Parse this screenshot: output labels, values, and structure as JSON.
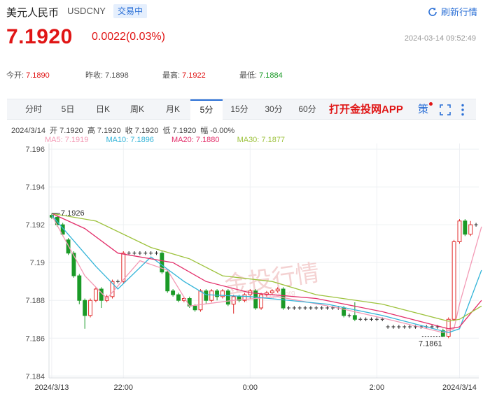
{
  "header": {
    "title": "美元人民币",
    "code": "USDCNY",
    "status": "交易中",
    "refresh_label": "刷新行情"
  },
  "quote": {
    "price": "7.1920",
    "change": "0.0022(0.03%)",
    "timestamp": "2024-03-14 09:52:49"
  },
  "stats": {
    "open_label": "今开:",
    "open": "7.1890",
    "prev_close_label": "昨收:",
    "prev_close": "7.1898",
    "high_label": "最高:",
    "high": "7.1922",
    "low_label": "最低:",
    "low": "7.1884"
  },
  "tabs": [
    "分时",
    "5日",
    "日K",
    "周K",
    "月K",
    "5分",
    "15分",
    "30分",
    "60分"
  ],
  "active_tab": "5分",
  "promo": "打开金投网APP",
  "tools": {
    "strategy": "策"
  },
  "ohlc_line": "2024/3/14  开 7.1920  高 7.1920  收 7.1920  低 7.1920  幅 -0.00%",
  "ma_legend": [
    {
      "label": "MA5: 7.1919",
      "color": "#f39ab5"
    },
    {
      "label": "MA10: 7.1896",
      "color": "#33b4d8"
    },
    {
      "label": "MA20: 7.1880",
      "color": "#e3306b"
    },
    {
      "label": "MA30: 7.1877",
      "color": "#9dc23c"
    }
  ],
  "watermark": "金投行情",
  "watermark_url": "quote.cngold.org",
  "chart_data": {
    "type": "candlestick",
    "y_ticks": [
      "7.196",
      "7.194",
      "7.192",
      "7.19",
      "7.188",
      "7.186",
      "7.184"
    ],
    "y_tick_values": [
      7.196,
      7.194,
      7.192,
      7.19,
      7.188,
      7.186,
      7.184
    ],
    "ylim": [
      7.1839,
      7.1963
    ],
    "x_labels": [
      "2024/3/13",
      "22:00",
      "0:00",
      "2:00",
      "2024/3/14"
    ],
    "x_label_index": [
      0,
      13,
      36,
      59,
      74
    ],
    "annotations": {
      "max": "7.1926",
      "min": "7.1861"
    },
    "candles": [
      [
        7.1925,
        7.1924,
        7.1926,
        7.1923
      ],
      [
        7.1924,
        7.192,
        7.1925,
        7.1919
      ],
      [
        7.192,
        7.1915,
        7.1921,
        7.1914
      ],
      [
        7.1912,
        7.1905,
        7.1913,
        7.1904
      ],
      [
        7.1905,
        7.1893,
        7.1906,
        7.1892
      ],
      [
        7.1893,
        7.188,
        7.1894,
        7.1878
      ],
      [
        7.188,
        7.1872,
        7.1881,
        7.1865
      ],
      [
        7.1872,
        7.188,
        7.1881,
        7.1871
      ],
      [
        7.188,
        7.1886,
        7.1887,
        7.1879
      ],
      [
        7.1886,
        7.188,
        7.1887,
        7.1876
      ],
      [
        7.188,
        7.1882,
        7.1883,
        7.1879
      ],
      [
        7.1882,
        7.189,
        7.1891,
        7.1881
      ],
      [
        7.189,
        7.189,
        7.1891,
        7.1889
      ],
      [
        7.189,
        7.1905,
        7.1906,
        7.1889
      ],
      [
        7.1905,
        7.1905,
        7.1906,
        7.1904
      ],
      [
        7.1905,
        7.1905,
        7.1906,
        7.1904
      ],
      [
        7.1905,
        7.1905,
        7.1906,
        7.1904
      ],
      [
        7.1905,
        7.1905,
        7.1906,
        7.1904
      ],
      [
        7.1905,
        7.1905,
        7.1906,
        7.1904
      ],
      [
        7.1905,
        7.1905,
        7.1906,
        7.1904
      ],
      [
        7.1905,
        7.1895,
        7.1906,
        7.1894
      ],
      [
        7.1895,
        7.1885,
        7.1896,
        7.1884
      ],
      [
        7.1885,
        7.1883,
        7.1886,
        7.1882
      ],
      [
        7.1883,
        7.188,
        7.1884,
        7.1879
      ],
      [
        7.188,
        7.1881,
        7.1882,
        7.1879
      ],
      [
        7.1881,
        7.1877,
        7.1882,
        7.1876
      ],
      [
        7.1877,
        7.1875,
        7.1878,
        7.1874
      ],
      [
        7.1875,
        7.1885,
        7.1886,
        7.1874
      ],
      [
        7.1885,
        7.188,
        7.1886,
        7.1878
      ],
      [
        7.188,
        7.1885,
        7.1886,
        7.1879
      ],
      [
        7.1885,
        7.1882,
        7.1886,
        7.188
      ],
      [
        7.1882,
        7.1885,
        7.1886,
        7.1881
      ],
      [
        7.1885,
        7.1878,
        7.1886,
        7.1877
      ],
      [
        7.1878,
        7.1882,
        7.1883,
        7.1873
      ],
      [
        7.1882,
        7.188,
        7.1883,
        7.1879
      ],
      [
        7.188,
        7.1883,
        7.1884,
        7.1879
      ],
      [
        7.1883,
        7.1885,
        7.1886,
        7.1881
      ],
      [
        7.1885,
        7.1876,
        7.1886,
        7.1875
      ],
      [
        7.1876,
        7.1883,
        7.1884,
        7.1875
      ],
      [
        7.1883,
        7.1884,
        7.1885,
        7.1882
      ],
      [
        7.1884,
        7.1885,
        7.1886,
        7.1883
      ],
      [
        7.1885,
        7.1886,
        7.1887,
        7.1884
      ],
      [
        7.1886,
        7.1876,
        7.1887,
        7.1875
      ],
      [
        7.1876,
        7.1876,
        7.1877,
        7.1875
      ],
      [
        7.1876,
        7.1876,
        7.1877,
        7.1875
      ],
      [
        7.1876,
        7.1876,
        7.1877,
        7.1875
      ],
      [
        7.1876,
        7.1876,
        7.1877,
        7.1875
      ],
      [
        7.1876,
        7.1876,
        7.1877,
        7.1875
      ],
      [
        7.1876,
        7.1876,
        7.1877,
        7.1875
      ],
      [
        7.1876,
        7.1876,
        7.1877,
        7.1875
      ],
      [
        7.1876,
        7.1876,
        7.1877,
        7.1875
      ],
      [
        7.1876,
        7.1876,
        7.1877,
        7.1875
      ],
      [
        7.1876,
        7.1876,
        7.1877,
        7.1875
      ],
      [
        7.1876,
        7.1872,
        7.1877,
        7.1871
      ],
      [
        7.1872,
        7.1872,
        7.1873,
        7.1871
      ],
      [
        7.1872,
        7.187,
        7.1879,
        7.1869
      ],
      [
        7.187,
        7.187,
        7.1871,
        7.1869
      ],
      [
        7.187,
        7.187,
        7.1871,
        7.1869
      ],
      [
        7.187,
        7.187,
        7.1871,
        7.1869
      ],
      [
        7.187,
        7.187,
        7.1871,
        7.1869
      ],
      [
        7.187,
        7.187,
        7.1871,
        7.1869
      ],
      [
        7.1866,
        7.1866,
        7.1867,
        7.1865
      ],
      [
        7.1866,
        7.1866,
        7.1867,
        7.1865
      ],
      [
        7.1866,
        7.1866,
        7.1867,
        7.1865
      ],
      [
        7.1866,
        7.1866,
        7.1867,
        7.1865
      ],
      [
        7.1866,
        7.1866,
        7.1867,
        7.1865
      ],
      [
        7.1866,
        7.1866,
        7.1867,
        7.1865
      ],
      [
        7.1866,
        7.1866,
        7.1867,
        7.1865
      ],
      [
        7.1866,
        7.1866,
        7.1867,
        7.1865
      ],
      [
        7.1866,
        7.1866,
        7.1867,
        7.1865
      ],
      [
        7.1866,
        7.1866,
        7.1867,
        7.1865
      ],
      [
        7.1864,
        7.1861,
        7.1865,
        7.1861
      ],
      [
        7.1861,
        7.187,
        7.1871,
        7.186
      ],
      [
        7.187,
        7.1911,
        7.1912,
        7.1869
      ],
      [
        7.1911,
        7.1922,
        7.1923,
        7.191
      ],
      [
        7.1922,
        7.1915,
        7.1923,
        7.1914
      ],
      [
        7.1915,
        7.192,
        7.1922,
        7.1914
      ],
      [
        7.192,
        7.192,
        7.1921,
        7.1919
      ]
    ],
    "ma_series": [
      {
        "name": "MA5",
        "color": "#f39ab5",
        "points": [
          [
            0,
            7.1925
          ],
          [
            6,
            7.1893
          ],
          [
            10,
            7.1881
          ],
          [
            16,
            7.1901
          ],
          [
            21,
            7.1896
          ],
          [
            25,
            7.1877
          ],
          [
            33,
            7.188
          ],
          [
            41,
            7.1882
          ],
          [
            52,
            7.1876
          ],
          [
            61,
            7.187
          ],
          [
            71,
            7.1863
          ],
          [
            73,
            7.1865
          ],
          [
            74,
            7.1878
          ],
          [
            78,
            7.1919
          ]
        ]
      },
      {
        "name": "MA10",
        "color": "#33b4d8",
        "points": [
          [
            0,
            7.1925
          ],
          [
            8,
            7.1898
          ],
          [
            12,
            7.1886
          ],
          [
            18,
            7.1903
          ],
          [
            24,
            7.189
          ],
          [
            28,
            7.1883
          ],
          [
            36,
            7.1882
          ],
          [
            50,
            7.1878
          ],
          [
            60,
            7.1872
          ],
          [
            72,
            7.1863
          ],
          [
            74,
            7.1865
          ],
          [
            78,
            7.1896
          ]
        ]
      },
      {
        "name": "MA20",
        "color": "#e3306b",
        "points": [
          [
            0,
            7.1926
          ],
          [
            6,
            7.1918
          ],
          [
            12,
            7.1905
          ],
          [
            22,
            7.19
          ],
          [
            28,
            7.189
          ],
          [
            36,
            7.1884
          ],
          [
            48,
            7.1881
          ],
          [
            60,
            7.1874
          ],
          [
            72,
            7.1865
          ],
          [
            74,
            7.1866
          ],
          [
            78,
            7.188
          ]
        ]
      },
      {
        "name": "MA30",
        "color": "#9dc23c",
        "points": [
          [
            0,
            7.1926
          ],
          [
            8,
            7.1922
          ],
          [
            18,
            7.1908
          ],
          [
            25,
            7.1902
          ],
          [
            31,
            7.1893
          ],
          [
            40,
            7.189
          ],
          [
            48,
            7.1883
          ],
          [
            60,
            7.1878
          ],
          [
            72,
            7.1869
          ],
          [
            74,
            7.187
          ],
          [
            78,
            7.1877
          ]
        ]
      }
    ],
    "grid": true
  }
}
